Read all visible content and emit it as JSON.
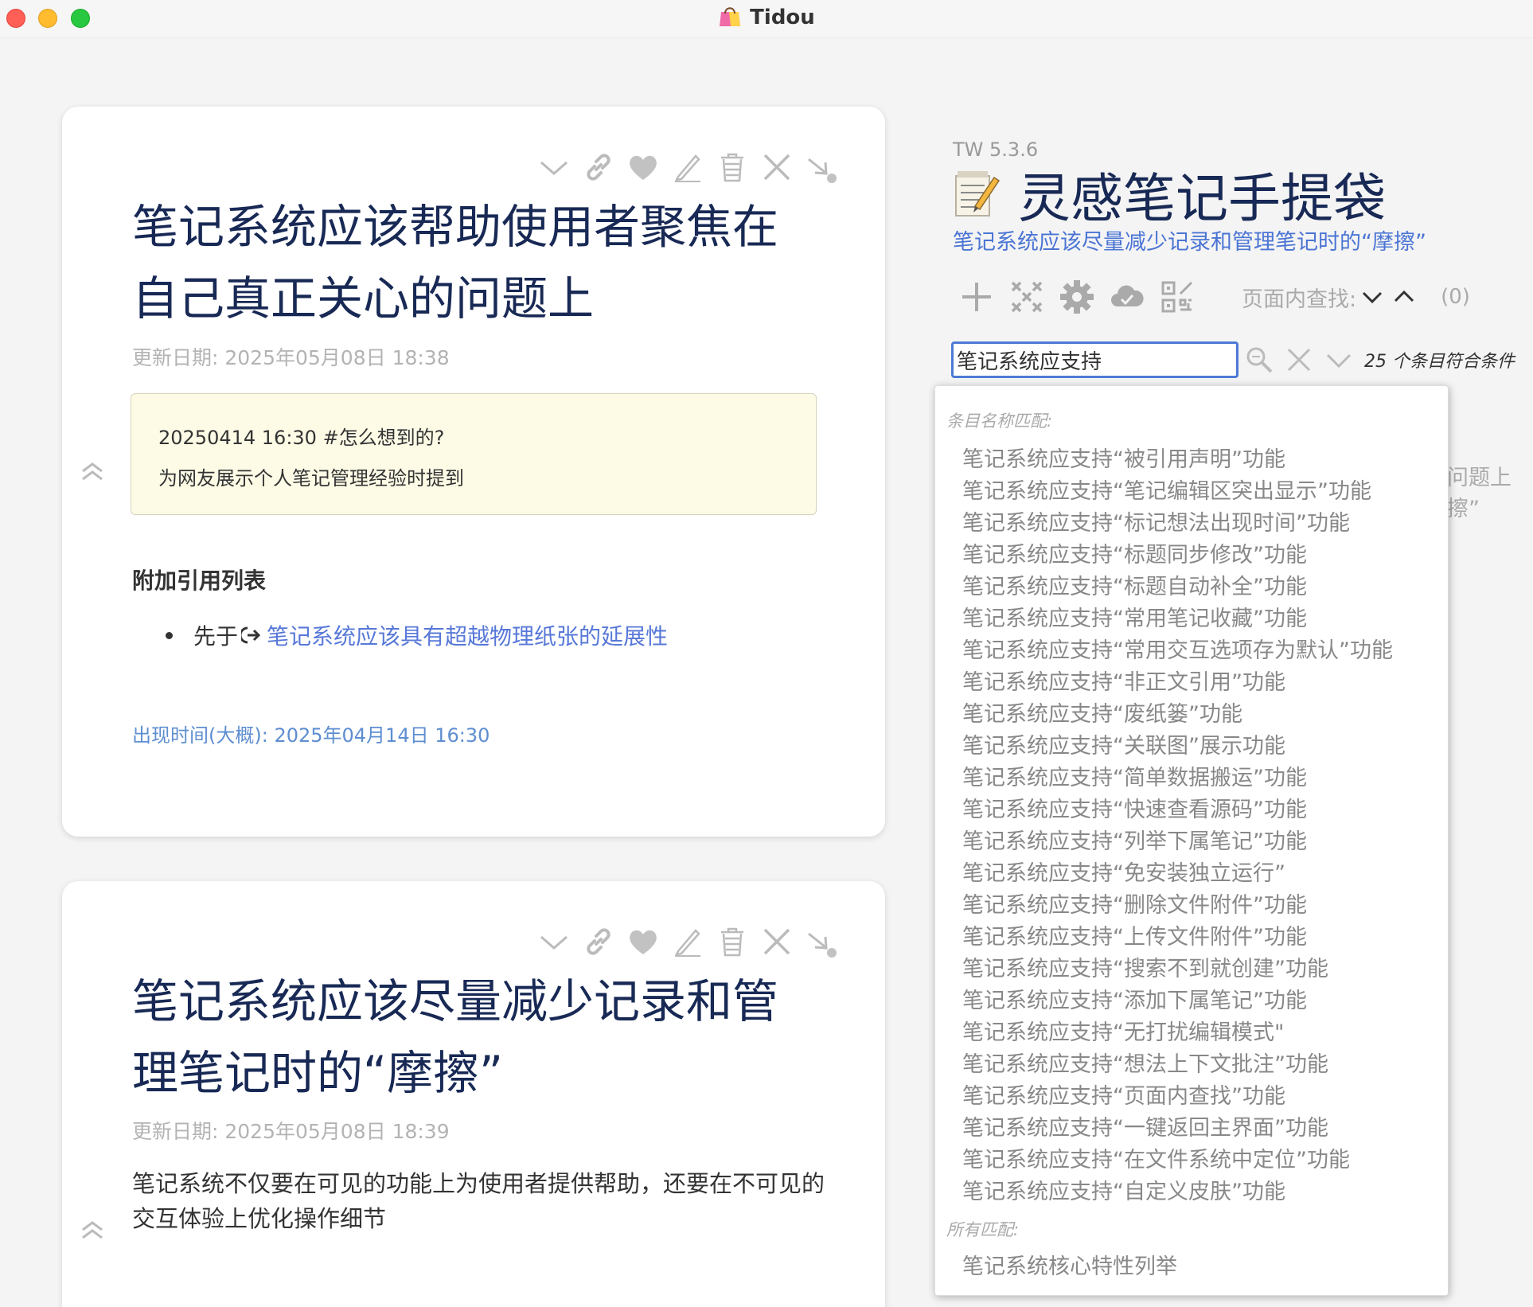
{
  "window": {
    "title": "Tidou"
  },
  "story": {
    "tiddlers": [
      {
        "title_lines": [
          "笔记系统应该帮助使用者聚焦在",
          "自己真正关心的问题上"
        ],
        "modified": "更新日期: 2025年05月08日 18:38",
        "note_lines": [
          "20250414 16:30 #怎么想到的?",
          "为网友展示个人笔记管理经验时提到"
        ],
        "refs_heading": "附加引用列表",
        "ref_prefix": "先于",
        "ref_link": "笔记系统应该具有超越物理纸张的延展性",
        "appear_time": "出现时间(大概): 2025年04月14日 16:30"
      },
      {
        "title_lines": [
          "笔记系统应该尽量减少记录和管",
          "理笔记时的“摩擦”"
        ],
        "modified": "更新日期: 2025年05月08日 18:39",
        "body": "笔记系统不仅要在可见的功能上为使用者提供帮助，还要在不可见的交互体验上优化操作细节"
      }
    ]
  },
  "sidebar": {
    "version": "TW 5.3.6",
    "site_title": "灵感笔记手提袋",
    "site_subtitle": "笔记系统应该尽量减少记录和管理笔记时的“摩擦”",
    "find_label": "页面内查找:",
    "find_count": "(0)",
    "search_value": "笔记系统应支持",
    "match_count": "25 个条目符合条件",
    "behind_text": [
      "问题上",
      "擦”"
    ]
  },
  "dropdown": {
    "title_heading": "条目名称匹配:",
    "title_matches": [
      "笔记系统应支持“被引用声明”功能",
      "笔记系统应支持“笔记编辑区突出显示”功能",
      "笔记系统应支持“标记想法出现时间”功能",
      "笔记系统应支持“标题同步修改”功能",
      "笔记系统应支持“标题自动补全”功能",
      "笔记系统应支持“常用笔记收藏”功能",
      "笔记系统应支持“常用交互选项存为默认”功能",
      "笔记系统应支持“非正文引用”功能",
      "笔记系统应支持“废纸篓”功能",
      "笔记系统应支持“关联图”展示功能",
      "笔记系统应支持“简单数据搬运”功能",
      "笔记系统应支持“快速查看源码”功能",
      "笔记系统应支持“列举下属笔记”功能",
      "笔记系统应支持“免安装独立运行”",
      "笔记系统应支持“删除文件附件”功能",
      "笔记系统应支持“上传文件附件”功能",
      "笔记系统应支持“搜索不到就创建”功能",
      "笔记系统应支持“添加下属笔记”功能",
      "笔记系统应支持“无打扰编辑模式\"",
      "笔记系统应支持“想法上下文批注”功能",
      "笔记系统应支持“页面内查找”功能",
      "笔记系统应支持“一键返回主界面”功能",
      "笔记系统应支持“在文件系统中定位”功能",
      "笔记系统应支持“自定义皮肤”功能"
    ],
    "all_heading": "所有匹配:",
    "all_matches": [
      "笔记系统核心特性列举"
    ]
  },
  "colors": {
    "title": "#182955",
    "link": "#5778d8",
    "accent": "#4d7ad6",
    "muted": "#b3b3b3",
    "note_bg": "#fdfbe6"
  },
  "icons": {
    "tiddler_controls": [
      "chevron-down-icon",
      "link-icon",
      "heart-icon",
      "pencil-icon",
      "trash-icon",
      "close-icon",
      "drag-arrow-icon"
    ],
    "sidebar_controls": [
      "plus-icon",
      "close-all-icon",
      "gear-icon",
      "cloud-icon",
      "qr-code-icon"
    ]
  }
}
